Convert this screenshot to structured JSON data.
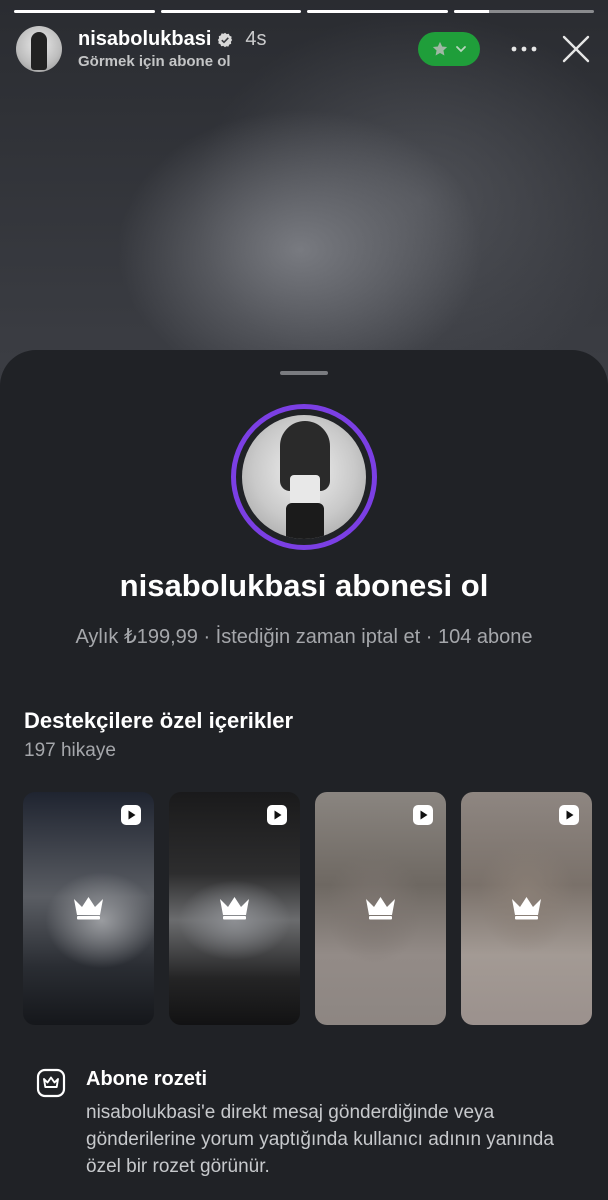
{
  "story": {
    "username": "nisabolukbasi",
    "time": "4s",
    "subtitle": "Görmek için abone ol",
    "progress": [
      1.0,
      1.0,
      1.0,
      0.25
    ],
    "colors": {
      "subscribe_pill": "#1f9e3a",
      "ring": "#7b3fe4"
    },
    "icons": {
      "verified": "verified-badge-icon",
      "star": "star-icon",
      "chevron": "chevron-down-icon",
      "more": "more-dots-icon",
      "close": "close-icon"
    }
  },
  "sheet": {
    "title": "nisabolukbasi abonesi ol",
    "meta": "Aylık ₺199,99 · İstediğin zaman iptal et · 104 abone",
    "section_title": "Destekçilere özel içerikler",
    "section_count": "197 hikaye",
    "thumbnails": [
      {
        "icon_top": "play-icon",
        "icon_center": "crown-icon"
      },
      {
        "icon_top": "play-icon",
        "icon_center": "crown-icon"
      },
      {
        "icon_top": "play-icon",
        "icon_center": "crown-icon"
      },
      {
        "icon_top": "play-icon",
        "icon_center": "crown-icon"
      }
    ],
    "badge": {
      "icon": "subscriber-badge-icon",
      "title": "Abone rozeti",
      "description": "nisabolukbasi'e direkt mesaj gönderdiğinde veya gönderilerine yorum yaptığında kullanıcı adının yanında özel bir rozet görünür."
    }
  }
}
